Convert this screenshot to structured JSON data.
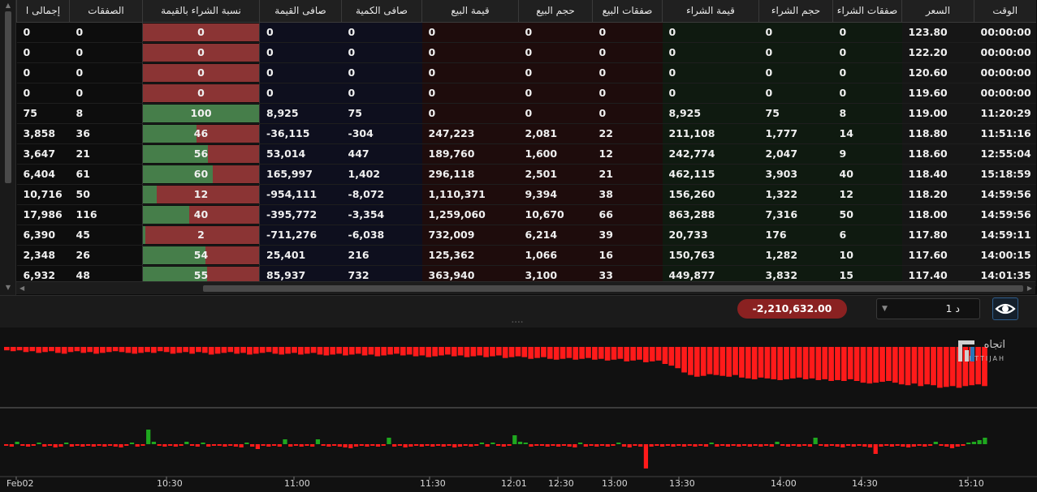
{
  "table": {
    "columns": [
      "الوقت",
      "السعر",
      "صفقات الشراء",
      "حجم الشراء",
      "قيمة الشراء",
      "صفقات البيع",
      "حجم البيع",
      "قيمة البيع",
      "صافى الكمية",
      "صافى القيمة",
      "نسبة الشراء بالقيمة",
      "الصفقات",
      "إجمالى ا"
    ],
    "rows": [
      {
        "time": "00:00:00",
        "price": "123.80",
        "buy_deals": "0",
        "buy_vol": "0",
        "buy_val": "0",
        "sell_deals": "0",
        "sell_vol": "0",
        "sell_val": "0",
        "net_qty": "0",
        "net_val": "0",
        "ratio": "0",
        "deals": "0",
        "total": "0"
      },
      {
        "time": "00:00:00",
        "price": "122.20",
        "buy_deals": "0",
        "buy_vol": "0",
        "buy_val": "0",
        "sell_deals": "0",
        "sell_vol": "0",
        "sell_val": "0",
        "net_qty": "0",
        "net_val": "0",
        "ratio": "0",
        "deals": "0",
        "total": "0"
      },
      {
        "time": "00:00:00",
        "price": "120.60",
        "buy_deals": "0",
        "buy_vol": "0",
        "buy_val": "0",
        "sell_deals": "0",
        "sell_vol": "0",
        "sell_val": "0",
        "net_qty": "0",
        "net_val": "0",
        "ratio": "0",
        "deals": "0",
        "total": "0"
      },
      {
        "time": "00:00:00",
        "price": "119.60",
        "buy_deals": "0",
        "buy_vol": "0",
        "buy_val": "0",
        "sell_deals": "0",
        "sell_vol": "0",
        "sell_val": "0",
        "net_qty": "0",
        "net_val": "0",
        "ratio": "0",
        "deals": "0",
        "total": "0"
      },
      {
        "time": "11:20:29",
        "price": "119.00",
        "buy_deals": "8",
        "buy_vol": "75",
        "buy_val": "8,925",
        "sell_deals": "0",
        "sell_vol": "0",
        "sell_val": "0",
        "net_qty": "75",
        "net_val": "8,925",
        "ratio": "100",
        "deals": "8",
        "total": "75"
      },
      {
        "time": "11:51:16",
        "price": "118.80",
        "buy_deals": "14",
        "buy_vol": "1,777",
        "buy_val": "211,108",
        "sell_deals": "22",
        "sell_vol": "2,081",
        "sell_val": "247,223",
        "net_qty": "304-",
        "net_val": "36,115-",
        "ratio": "46",
        "deals": "36",
        "total": "3,858"
      },
      {
        "time": "12:55:04",
        "price": "118.60",
        "buy_deals": "9",
        "buy_vol": "2,047",
        "buy_val": "242,774",
        "sell_deals": "12",
        "sell_vol": "1,600",
        "sell_val": "189,760",
        "net_qty": "447",
        "net_val": "53,014",
        "ratio": "56",
        "deals": "21",
        "total": "3,647"
      },
      {
        "time": "15:18:59",
        "price": "118.40",
        "buy_deals": "40",
        "buy_vol": "3,903",
        "buy_val": "462,115",
        "sell_deals": "21",
        "sell_vol": "2,501",
        "sell_val": "296,118",
        "net_qty": "1,402",
        "net_val": "165,997",
        "ratio": "60",
        "deals": "61",
        "total": "6,404"
      },
      {
        "time": "14:59:56",
        "price": "118.20",
        "buy_deals": "12",
        "buy_vol": "1,322",
        "buy_val": "156,260",
        "sell_deals": "38",
        "sell_vol": "9,394",
        "sell_val": "1,110,371",
        "net_qty": "8,072-",
        "net_val": "954,111-",
        "ratio": "12",
        "deals": "50",
        "total": "10,716"
      },
      {
        "time": "14:59:56",
        "price": "118.00",
        "buy_deals": "50",
        "buy_vol": "7,316",
        "buy_val": "863,288",
        "sell_deals": "66",
        "sell_vol": "10,670",
        "sell_val": "1,259,060",
        "net_qty": "3,354-",
        "net_val": "395,772-",
        "ratio": "40",
        "deals": "116",
        "total": "17,986"
      },
      {
        "time": "14:59:11",
        "price": "117.80",
        "buy_deals": "6",
        "buy_vol": "176",
        "buy_val": "20,733",
        "sell_deals": "39",
        "sell_vol": "6,214",
        "sell_val": "732,009",
        "net_qty": "6,038-",
        "net_val": "711,276-",
        "ratio": "2",
        "deals": "45",
        "total": "6,390"
      },
      {
        "time": "14:00:15",
        "price": "117.60",
        "buy_deals": "10",
        "buy_vol": "1,282",
        "buy_val": "150,763",
        "sell_deals": "16",
        "sell_vol": "1,066",
        "sell_val": "125,362",
        "net_qty": "216",
        "net_val": "25,401",
        "ratio": "54",
        "deals": "26",
        "total": "2,348"
      },
      {
        "time": "14:01:35",
        "price": "117.40",
        "buy_deals": "15",
        "buy_vol": "3,832",
        "buy_val": "449,877",
        "sell_deals": "33",
        "sell_vol": "3,100",
        "sell_val": "363,940",
        "net_qty": "732",
        "net_val": "85,937",
        "ratio": "55",
        "deals": "48",
        "total": "6,932"
      }
    ]
  },
  "summary": {
    "net_value": "-2,210,632.00",
    "interval": "1 د",
    "eye_icon": "eye-icon"
  },
  "logo": {
    "arabic": "اتجاه",
    "latin": "ETTIJAH"
  },
  "colors": {
    "buy": "#467e4a",
    "sell": "#8b3434",
    "chart_red": "#ff1a1a",
    "chart_green": "#1fa81f",
    "badge": "#8a2121",
    "accent": "#2f5d8c"
  },
  "chart_data": {
    "type": "bar",
    "x_ticks": [
      "Feb02",
      "10:30",
      "11:00",
      "11:30",
      "12:01",
      "12:30",
      "13:00",
      "13:30",
      "14:00",
      "14:30",
      "15:10"
    ],
    "cumulative_top": [
      -4,
      -5,
      -4,
      -6,
      -5,
      -7,
      -6,
      -5,
      -7,
      -8,
      -6,
      -5,
      -7,
      -6,
      -8,
      -7,
      -6,
      -5,
      -6,
      -7,
      -8,
      -7,
      -6,
      -7,
      -5,
      -6,
      -8,
      -7,
      -6,
      -8,
      -6,
      -7,
      -9,
      -8,
      -7,
      -6,
      -8,
      -7,
      -9,
      -8,
      -7,
      -6,
      -8,
      -9,
      -8,
      -7,
      -9,
      -8,
      -7,
      -9,
      -10,
      -9,
      -8,
      -10,
      -9,
      -8,
      -10,
      -9,
      -11,
      -10,
      -9,
      -8,
      -10,
      -9,
      -11,
      -10,
      -12,
      -11,
      -10,
      -9,
      -11,
      -10,
      -12,
      -11,
      -10,
      -12,
      -11,
      -10,
      -13,
      -12,
      -11,
      -12,
      -14,
      -13,
      -12,
      -14,
      -15,
      -14,
      -13,
      -15,
      -14,
      -13,
      -15,
      -14,
      -16,
      -15,
      -14,
      -17,
      -16,
      -15,
      -18,
      -17,
      -16,
      -20,
      -22,
      -25,
      -30,
      -33,
      -35,
      -34,
      -32,
      -33,
      -34,
      -35,
      -33,
      -36,
      -37,
      -38,
      -36,
      -37,
      -38,
      -39,
      -38,
      -37,
      -36,
      -38,
      -37,
      -39,
      -38,
      -40,
      -39,
      -40,
      -38,
      -40,
      -42,
      -43,
      -42,
      -41,
      -40,
      -42,
      -44,
      -45,
      -43,
      -46,
      -44,
      -45,
      -48,
      -47,
      -46,
      -48,
      -46,
      -45,
      -44,
      -46
    ],
    "net_bottom": [
      -2,
      -3,
      3,
      -2,
      -3,
      -2,
      2,
      -3,
      -2,
      -4,
      -3,
      2,
      -3,
      -2,
      -3,
      -2,
      -3,
      -2,
      -3,
      -2,
      -3,
      -4,
      -2,
      2,
      -3,
      -2,
      18,
      3,
      -2,
      -3,
      -2,
      -3,
      -2,
      3,
      -2,
      -3,
      2,
      -3,
      -2,
      -2,
      -3,
      -2,
      -3,
      -4,
      2,
      -3,
      -6,
      -2,
      -3,
      -2,
      -3,
      6,
      -3,
      -2,
      -3,
      -2,
      -3,
      6,
      -2,
      -3,
      -2,
      -3,
      -4,
      -5,
      -3,
      -2,
      -3,
      -2,
      -3,
      -2,
      8,
      -3,
      -2,
      -4,
      -3,
      -2,
      -3,
      -2,
      -3,
      -2,
      -3,
      -2,
      -4,
      -3,
      -2,
      -3,
      -2,
      2,
      -3,
      2,
      -2,
      -3,
      -2,
      11,
      3,
      2,
      -3,
      -2,
      -2,
      -3,
      -2,
      -3,
      -2,
      -3,
      -4,
      2,
      -3,
      -2,
      -3,
      -2,
      -3,
      -2,
      2,
      -3,
      -4,
      -2,
      -3,
      -30,
      -3,
      -2,
      -3,
      -2,
      -3,
      -2,
      -3,
      -2,
      -3,
      -2,
      -3,
      2,
      -3,
      -2,
      -3,
      -2,
      -3,
      -2,
      -3,
      -2,
      -3,
      -2,
      -3,
      3,
      -2,
      -3,
      -2,
      -3,
      -2,
      -3,
      8,
      -2,
      -3,
      -2,
      -3,
      -4,
      -2,
      -3,
      -2,
      -3,
      -4,
      -12,
      -3,
      -2,
      -3,
      -2,
      -3,
      -4,
      -3,
      -2,
      -3,
      -2,
      3,
      -2,
      -3,
      -5,
      -3,
      -2,
      2,
      3,
      5,
      8
    ]
  }
}
